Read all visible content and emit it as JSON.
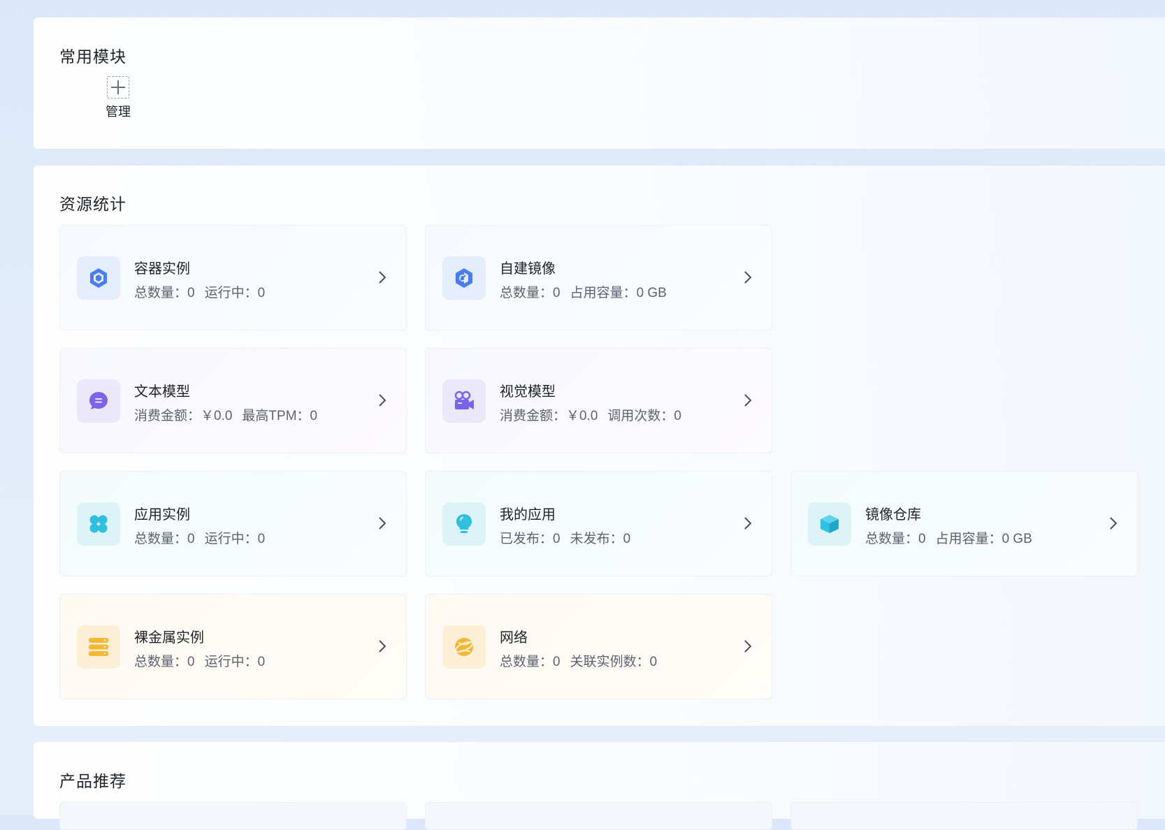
{
  "common": {
    "title": "常用模块",
    "manage_label": "管理"
  },
  "resources": {
    "title": "资源统计",
    "cards": [
      {
        "title": "容器实例",
        "stat1": "总数量：0",
        "stat2": "运行中：0",
        "icon": "cube-icon",
        "theme": "blue"
      },
      {
        "title": "自建镜像",
        "stat1": "总数量：0",
        "stat2": "占用容量：0 GB",
        "icon": "image-layers-icon",
        "theme": "blue"
      },
      {
        "title": "文本模型",
        "stat1": "消费金额：￥0.0",
        "stat2": "最高TPM：0",
        "icon": "chat-bubble-icon",
        "theme": "purple"
      },
      {
        "title": "视觉模型",
        "stat1": "消费金额：￥0.0",
        "stat2": "调用次数：0",
        "icon": "video-camera-icon",
        "theme": "purple"
      },
      {
        "title": "应用实例",
        "stat1": "总数量：0",
        "stat2": "运行中：0",
        "icon": "clover-icon",
        "theme": "cyan"
      },
      {
        "title": "我的应用",
        "stat1": "已发布：0",
        "stat2": "未发布：0",
        "icon": "lightbulb-icon",
        "theme": "cyan"
      },
      {
        "title": "镜像仓库",
        "stat1": "总数量：0",
        "stat2": "占用容量：0 GB",
        "icon": "box-icon",
        "theme": "cyan"
      },
      {
        "title": "裸金属实例",
        "stat1": "总数量：0",
        "stat2": "运行中：0",
        "icon": "server-icon",
        "theme": "amber"
      },
      {
        "title": "网络",
        "stat1": "总数量：0",
        "stat2": "关联实例数：0",
        "icon": "globe-icon",
        "theme": "amber"
      }
    ]
  },
  "products": {
    "title": "产品推荐"
  },
  "colors": {
    "blue": "#4a7cf3",
    "purple": "#7b63ee",
    "cyan": "#2fbfe0",
    "amber": "#f5b731"
  }
}
